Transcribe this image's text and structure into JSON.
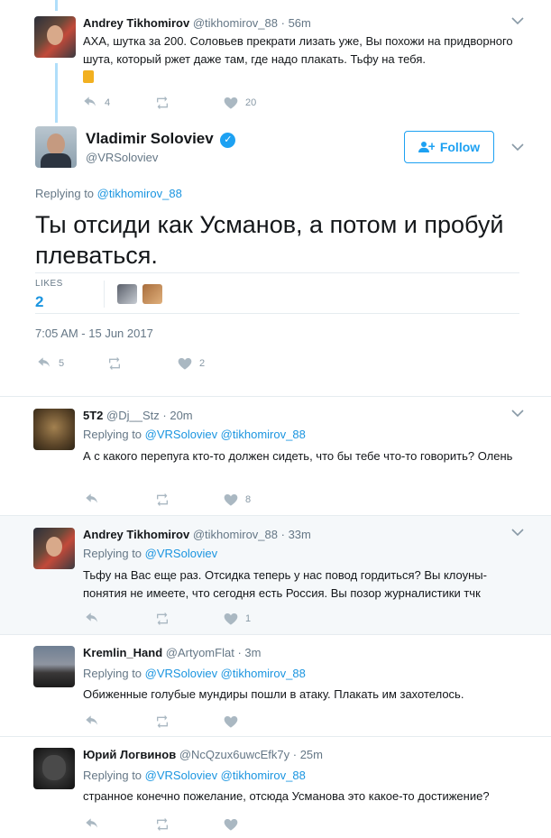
{
  "tweets": [
    {
      "name": "Andrey Tikhomirov",
      "handle": "@tikhomirov_88",
      "time": "56m",
      "text": "АХА, шутка за 200. Соловьев прекрати лизать уже, Вы похожи на придворного шута, который ржет даже там, где надо плакать. Тьфу на тебя.",
      "replies": "4",
      "retweets": "",
      "likes": "20"
    }
  ],
  "main_tweet": {
    "name": "Vladimir Soloviev",
    "handle": "@VRSoloviev",
    "follow_label": "Follow",
    "replying_prefix": "Replying to",
    "replying_to": "@tikhomirov_88",
    "text": "Ты отсиди как Усманов, а потом и пробуй плеваться.",
    "likes_label": "LIKES",
    "likes_count": "2",
    "timestamp": "7:05 AM - 15 Jun 2017",
    "replies": "5",
    "likes": "2"
  },
  "replies": [
    {
      "name": "5T2",
      "handle": "@Dj__Stz",
      "time": "20m",
      "replying_prefix": "Replying to",
      "replying_to": "@VRSoloviev @tikhomirov_88",
      "text": "А с какого перепуга кто-то должен сидеть, что бы тебе что-то говорить? Олень",
      "likes": "8"
    },
    {
      "name": "Andrey Tikhomirov",
      "handle": "@tikhomirov_88",
      "time": "33m",
      "replying_prefix": "Replying to",
      "replying_to": "@VRSoloviev",
      "text": "Тьфу на Вас еще раз. Отсидка теперь у нас повод гордиться? Вы клоуны- понятия не имеете, что сегодня есть Россия. Вы позор журналистики тчк",
      "likes": "1"
    },
    {
      "name": "Kremlin_Hand",
      "handle": "@ArtyomFlat",
      "time": "3m",
      "replying_prefix": "Replying to",
      "replying_to": "@VRSoloviev @tikhomirov_88",
      "text": "Обиженные голубые мундиры пошли в атаку. Плакать им захотелось.",
      "likes": ""
    },
    {
      "name": "Юрий Логвинов",
      "handle": "@NcQzux6uwcEfk7y",
      "time": "25m",
      "replying_prefix": "Replying to",
      "replying_to": "@VRSoloviev @tikhomirov_88",
      "text": "странное конечно пожелание, отсюда Усманова это какое-то достижение?",
      "likes": ""
    }
  ],
  "separator_dot": "·",
  "icons": [
    "reply-icon",
    "retweet-icon",
    "like-icon",
    "caret-down-icon",
    "verified-icon",
    "follow-icon",
    "thumbs-down-emoji"
  ],
  "colors": {
    "accent": "#1da1f2",
    "link": "#1b95e0",
    "muted": "#657786"
  }
}
